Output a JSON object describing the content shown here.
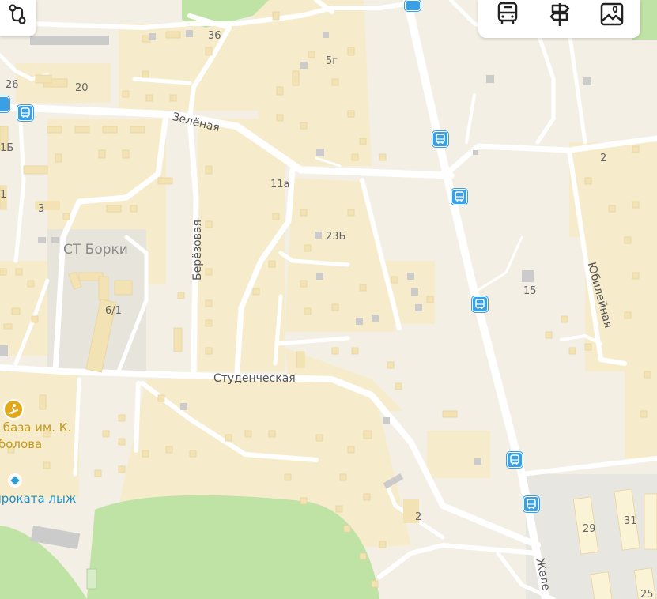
{
  "streets": {
    "zelenaya": "Зелёная",
    "berezovaya": "Берёзовая",
    "studencheskaya": "Студенческая",
    "yubileynaya": "Юбилейная",
    "zheleznodorozhnaya": "Желе"
  },
  "area_label": "СТ Борки",
  "house_numbers": [
    "36",
    "5г",
    "26",
    "20",
    "1Б",
    "11а",
    "1",
    "3",
    "23Б",
    "6/1",
    "15",
    "2",
    "2",
    "29",
    "31",
    "25"
  ],
  "pois": {
    "ski_base": {
      "line1": "я база им. К.",
      "line2": "болова",
      "color": "#c59a1a",
      "icon": "skier-icon"
    },
    "ski_rental": {
      "label": "проката лыж",
      "color": "#1f8fbf",
      "icon": "rental-diamond-icon"
    }
  },
  "toolbar": {
    "left_button_icon": "route-icon",
    "buttons": [
      {
        "icon": "transit-bus-icon"
      },
      {
        "icon": "signpost-icon"
      },
      {
        "icon": "photo-pin-icon"
      }
    ]
  },
  "colors": {
    "background": "#f3efe4",
    "block": "#f6eccc",
    "building": "#f3e3b4",
    "gray_building": "#cfcfcf",
    "forest": "#bfe3a4",
    "road": "#ffffff",
    "stop": "#3aa0e6"
  }
}
